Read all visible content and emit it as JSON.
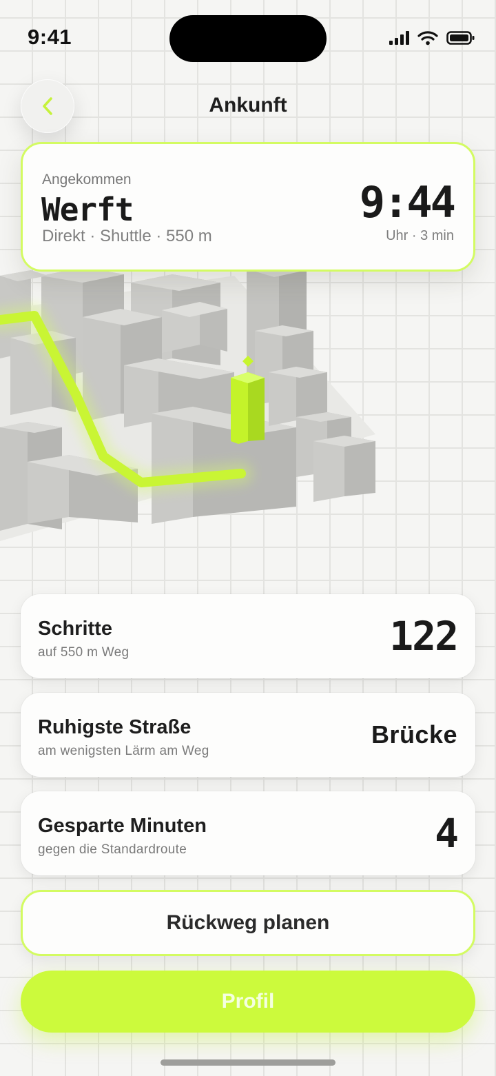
{
  "status_bar": {
    "time": "9:41"
  },
  "header": {
    "title": "Ankunft"
  },
  "arrival": {
    "label": "Angekommen",
    "destination": "Werft",
    "details": "Direkt · Shuttle · 550 m",
    "time": "9:44",
    "time_sub": "Uhr · 3 min"
  },
  "stats": [
    {
      "title": "Schritte",
      "subtitle": "auf 550 m Weg",
      "value": "122"
    },
    {
      "title": "Ruhigste Straße",
      "subtitle": "am wenigsten Lärm am Weg",
      "value": "Brücke"
    },
    {
      "title": "Gesparte Minuten",
      "subtitle": "gegen die Standardroute",
      "value": "4"
    }
  ],
  "actions": {
    "secondary_label": "Rückweg planen",
    "primary_label": "Profil"
  },
  "colors": {
    "accent": "#ccfa3c",
    "accent_border": "#d3fb62",
    "background": "#f5f5f3"
  }
}
